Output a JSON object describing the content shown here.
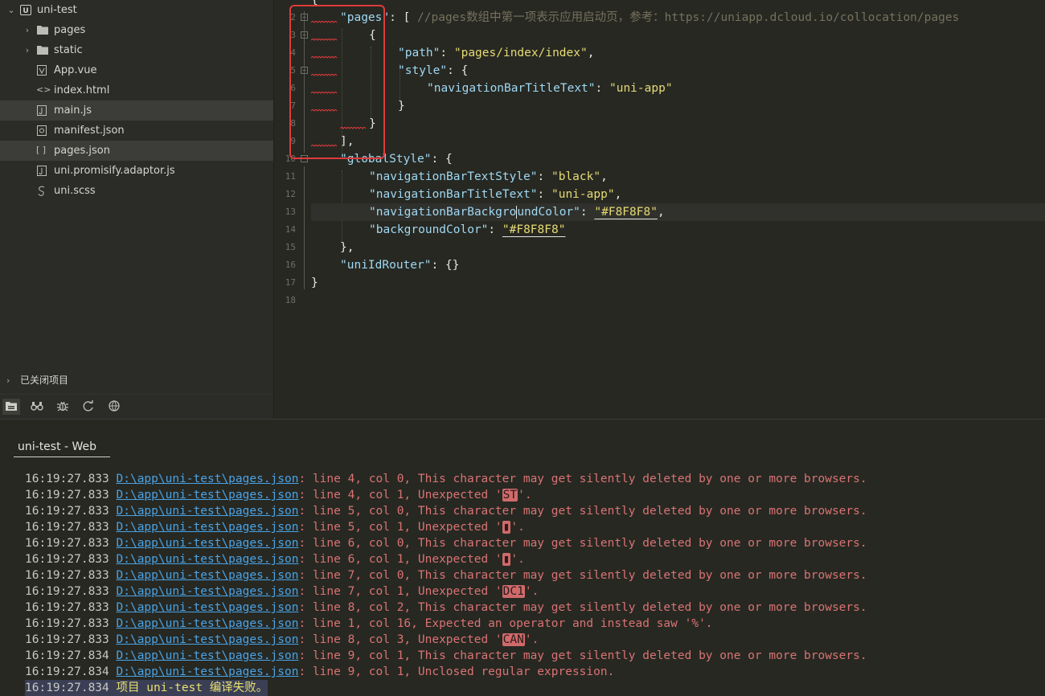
{
  "sidebar": {
    "root": {
      "label": "uni-test"
    },
    "items": [
      {
        "label": "pages",
        "icon": "folder-icon"
      },
      {
        "label": "static",
        "icon": "folder-icon"
      },
      {
        "label": "App.vue",
        "icon": "vue-file-icon"
      },
      {
        "label": "index.html",
        "icon": "html-file-icon"
      },
      {
        "label": "main.js",
        "icon": "js-file-icon"
      },
      {
        "label": "manifest.json",
        "icon": "manifest-file-icon"
      },
      {
        "label": "pages.json",
        "icon": "json-file-icon"
      },
      {
        "label": "uni.promisify.adaptor.js",
        "icon": "js-file-icon"
      },
      {
        "label": "uni.scss",
        "icon": "scss-file-icon"
      }
    ],
    "closed_projects": {
      "label": "已关闭项目"
    },
    "toolbar": [
      "project-manager-icon",
      "binoculars-icon",
      "bug-icon",
      "refresh-icon",
      "globe-icon"
    ]
  },
  "editor": {
    "line1_fragment": "{",
    "line2": {
      "key": "\"pages\"",
      "rest": ": [ ",
      "comment": "//pages数组中第一项表示应用启动页，参考：https://uniapp.dcloud.io/collocation/pages"
    },
    "line3": {
      "text": "{"
    },
    "line4": {
      "key": "\"path\"",
      "sep": ": ",
      "val": "\"pages/index/index\"",
      "end": ","
    },
    "line5": {
      "key": "\"style\"",
      "rest": ": {"
    },
    "line6": {
      "key": "\"navigationBarTitleText\"",
      "sep": ": ",
      "val": "\"uni-app\""
    },
    "line7": {
      "text": "}"
    },
    "line8": {
      "text": "}"
    },
    "line9": {
      "text": "],"
    },
    "line10": {
      "key": "\"globalStyle\"",
      "rest": ": {"
    },
    "line11": {
      "key": "\"navigationBarTextStyle\"",
      "sep": ": ",
      "val": "\"black\"",
      "end": ","
    },
    "line12": {
      "key": "\"navigationBarTitleText\"",
      "sep": ": ",
      "val": "\"uni-app\"",
      "end": ","
    },
    "line13": {
      "key1": "\"navigationBarBackgro",
      "key2": "undColor\"",
      "sep": ": ",
      "q1": "\"",
      "val": "#F8F8F8",
      "q2": "\"",
      "end": ","
    },
    "line14": {
      "key": "\"backgroundColor\"",
      "sep": ": ",
      "q1": "\"",
      "val": "#F8F8F8",
      "q2": "\""
    },
    "line15": {
      "text": "},"
    },
    "line16": {
      "key": "\"uniIdRouter\"",
      "rest": ": {}"
    },
    "line17": {
      "text": "}"
    },
    "line_numbers": [
      "2",
      "3",
      "4",
      "5",
      "6",
      "7",
      "8",
      "9",
      "10",
      "11",
      "12",
      "13",
      "14",
      "15",
      "16",
      "17",
      "18"
    ]
  },
  "panel": {
    "tab_label": "uni-test - Web"
  },
  "console": {
    "entries": [
      {
        "ts": "16:19:27.833",
        "file": "D:\\app\\uni-test\\pages.json",
        "msg": ": line 4, col 0, This character may get silently deleted by one or more browsers."
      },
      {
        "ts": "16:19:27.833",
        "file": "D:\\app\\uni-test\\pages.json",
        "msg": ": line 4, col 1, Unexpected '",
        "char": "ST",
        "after": "'."
      },
      {
        "ts": "16:19:27.833",
        "file": "D:\\app\\uni-test\\pages.json",
        "msg": ": line 5, col 0, This character may get silently deleted by one or more browsers."
      },
      {
        "ts": "16:19:27.833",
        "file": "D:\\app\\uni-test\\pages.json",
        "msg": ": line 5, col 1, Unexpected '",
        "char": "▮",
        "after": "'."
      },
      {
        "ts": "16:19:27.833",
        "file": "D:\\app\\uni-test\\pages.json",
        "msg": ": line 6, col 0, This character may get silently deleted by one or more browsers."
      },
      {
        "ts": "16:19:27.833",
        "file": "D:\\app\\uni-test\\pages.json",
        "msg": ": line 6, col 1, Unexpected '",
        "char": "▮",
        "after": "'."
      },
      {
        "ts": "16:19:27.833",
        "file": "D:\\app\\uni-test\\pages.json",
        "msg": ": line 7, col 0, This character may get silently deleted by one or more browsers."
      },
      {
        "ts": "16:19:27.833",
        "file": "D:\\app\\uni-test\\pages.json",
        "msg": ": line 7, col 1, Unexpected '",
        "char": "DC1",
        "after": "'."
      },
      {
        "ts": "16:19:27.833",
        "file": "D:\\app\\uni-test\\pages.json",
        "msg": ": line 8, col 2, This character may get silently deleted by one or more browsers."
      },
      {
        "ts": "16:19:27.833",
        "file": "D:\\app\\uni-test\\pages.json",
        "msg": ": line 1, col 16, Expected an operator and instead saw '%'."
      },
      {
        "ts": "16:19:27.833",
        "file": "D:\\app\\uni-test\\pages.json",
        "msg": ": line 8, col 3, Unexpected '",
        "char": "CAN",
        "after": "'."
      },
      {
        "ts": "16:19:27.834",
        "file": "D:\\app\\uni-test\\pages.json",
        "msg": ": line 9, col 1, This character may get silently deleted by one or more browsers."
      },
      {
        "ts": "16:19:27.834",
        "file": "D:\\app\\uni-test\\pages.json",
        "msg": ": line 9, col 1, Unclosed regular expression."
      }
    ],
    "final": {
      "ts": "16:19:27.834",
      "msg": "项目 uni-test 编译失败。"
    }
  },
  "colors": {
    "error": "#d97373",
    "link": "#4aa3e6",
    "highlight_box": "#e03a3a"
  }
}
